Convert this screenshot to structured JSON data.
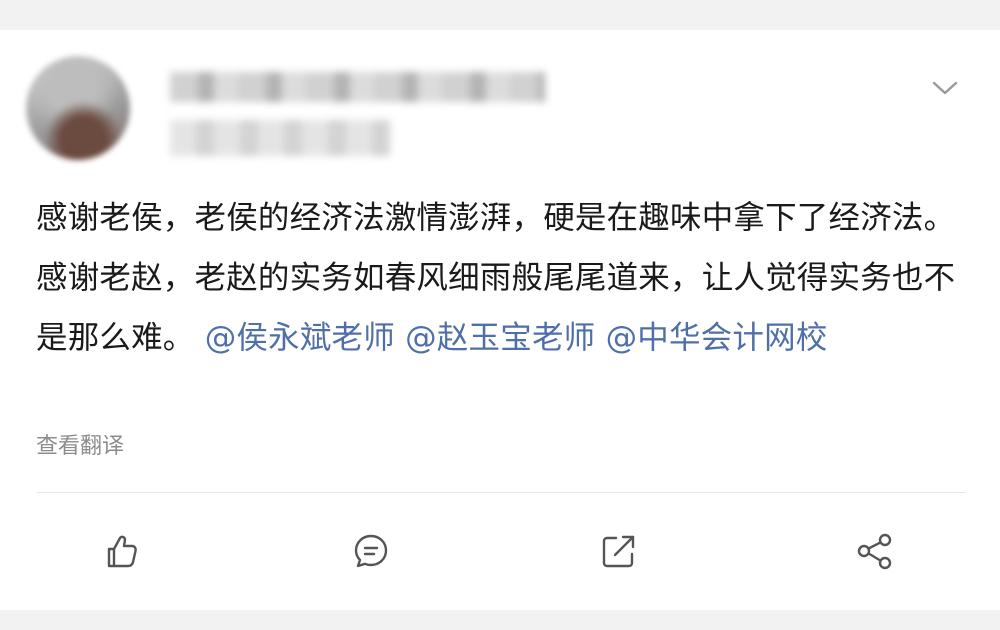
{
  "post": {
    "text_plain": "感谢老侯，老侯的经济法激情澎湃，硬是在趣味中拿下了经济法。感谢老赵，老赵的实务如春风细雨般尾尾道来，让人觉得实务也不是那么难。",
    "mentions": [
      "@侯永斌老师",
      "@赵玉宝老师",
      "@中华会计网校"
    ],
    "translate_label": "查看翻译"
  },
  "icons": {
    "menu": "chevron-down-icon",
    "like": "thumbs-up-icon",
    "comment": "comment-icon",
    "repost": "repost-icon",
    "share": "share-icon"
  },
  "colors": {
    "mention": "#4f6fa8",
    "text": "#1a1a1a",
    "muted": "#8c8c8c",
    "icon": "#555555",
    "background": "#f2f2f2"
  }
}
